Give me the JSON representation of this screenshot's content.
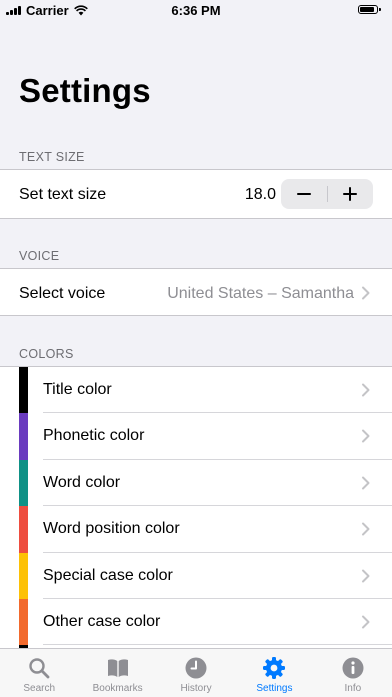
{
  "status_bar": {
    "carrier": "Carrier",
    "time": "6:36 PM"
  },
  "page_title": "Settings",
  "text_size": {
    "header": "TEXT SIZE",
    "label": "Set text size",
    "value": "18.0",
    "decrement_symbol": "−",
    "increment_symbol": "+"
  },
  "voice": {
    "header": "VOICE",
    "label": "Select voice",
    "value": "United States – Samantha"
  },
  "colors": {
    "header": "COLORS",
    "items": [
      {
        "label": "Title color",
        "color": "#000000"
      },
      {
        "label": "Phonetic color",
        "color": "#6a3bbf"
      },
      {
        "label": "Word color",
        "color": "#0f9186"
      },
      {
        "label": "Word position color",
        "color": "#ee4d3f"
      },
      {
        "label": "Special case color",
        "color": "#fdc106"
      },
      {
        "label": "Other case color",
        "color": "#f26a2d"
      },
      {
        "label": "",
        "color": "#000000"
      }
    ]
  },
  "tab_bar": {
    "active_color": "#007aff",
    "inactive_color": "#8e8e93",
    "tabs": [
      {
        "label": "Search",
        "icon": "magnifier-icon"
      },
      {
        "label": "Bookmarks",
        "icon": "book-icon"
      },
      {
        "label": "History",
        "icon": "clock-icon"
      },
      {
        "label": "Settings",
        "icon": "gear-icon"
      },
      {
        "label": "Info",
        "icon": "info-icon"
      }
    ]
  }
}
